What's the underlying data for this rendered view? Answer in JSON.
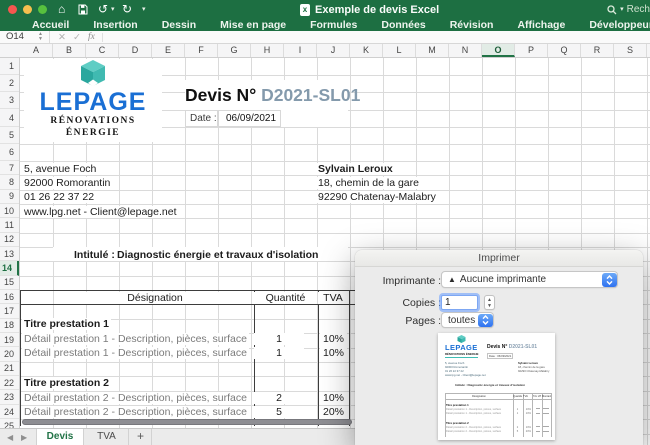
{
  "window": {
    "title": "Exemple de devis Excel",
    "search_label": "Rech",
    "menu_items": [
      "Accueil",
      "Insertion",
      "Dessin",
      "Mise en page",
      "Formules",
      "Données",
      "Révision",
      "Affichage",
      "Développeur"
    ],
    "name_box": "O14",
    "fx_label": "fx",
    "cancel_glyph": "✕",
    "enter_glyph": "✓"
  },
  "grid": {
    "columns": [
      "A",
      "B",
      "C",
      "D",
      "E",
      "F",
      "G",
      "H",
      "I",
      "J",
      "K",
      "L",
      "M",
      "N",
      "O",
      "P",
      "Q",
      "R",
      "S"
    ],
    "rows": [
      "1",
      "2",
      "3",
      "4",
      "5",
      "6",
      "7",
      "8",
      "9",
      "10",
      "11",
      "12",
      "13",
      "14",
      "15",
      "16",
      "17",
      "18",
      "19",
      "20",
      "21",
      "22",
      "23",
      "24",
      "25"
    ],
    "selected_column": "O",
    "selected_row": "14"
  },
  "invoice": {
    "logo_name": "LEPAGE",
    "logo_tagline": "RÉNOVATIONS ÉNERGIE",
    "title_label": "Devis N°",
    "title_number": "D2021-SL01",
    "date_label": "Date :",
    "date_value": "06/09/2021",
    "company_lines": [
      "5, avenue Foch",
      "92000 Romorantin",
      "01 26 22 37 22",
      "www.lpg.net - Client@lepage.net"
    ],
    "client_lines": [
      "Sylvain Leroux",
      "18, chemin de la gare",
      "92290 Chatenay-Malabry"
    ],
    "subject_label": "Intitulé :",
    "subject": "Diagnostic énergie et travaux d'isolation",
    "table": {
      "headers": [
        "Désignation",
        "Quantité",
        "TVA"
      ],
      "rows": [
        {
          "label": "Titre prestation 1",
          "qty": "",
          "tva": ""
        },
        {
          "label": "Détail prestation 1 - Description, pièces, surface",
          "qty": "1",
          "tva": "10%"
        },
        {
          "label": "Détail prestation 1 - Description, pièces, surface",
          "qty": "1",
          "tva": "10%"
        },
        {
          "label": "Titre prestation 2",
          "qty": "",
          "tva": ""
        },
        {
          "label": "Détail prestation 2 - Description, pièces, surface",
          "qty": "2",
          "tva": "10%"
        },
        {
          "label": "Détail prestation 2 - Description, pièces, surface",
          "qty": "5",
          "tva": "20%"
        }
      ]
    }
  },
  "sheet_tabs": {
    "tabs": [
      "Devis",
      "TVA"
    ],
    "active": "Devis",
    "add_label": "+"
  },
  "print_dialog": {
    "title": "Imprimer",
    "printer_label": "Imprimante :",
    "printer_value": "Aucune imprimante",
    "copies_label": "Copies :",
    "copies_value": "1",
    "pages_label": "Pages :",
    "pages_value": "toutes",
    "preview_headers": [
      "Désignation",
      "Quantité",
      "TVA",
      "Prix HT",
      "Montant TTC"
    ]
  },
  "colors": {
    "green": "#1d6f42",
    "accent-green": "#217346",
    "logo-blue": "#1a6fd4",
    "steel": "#849aac",
    "teal": "#3fbdb4",
    "mac-blue1": "#6daaf8",
    "mac-blue2": "#2f72f0"
  }
}
